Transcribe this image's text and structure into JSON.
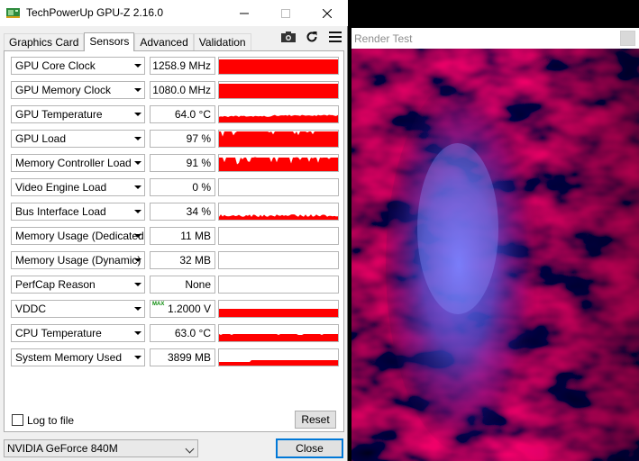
{
  "gpuz": {
    "title": "TechPowerUp GPU-Z 2.16.0",
    "icons": {
      "app": "gpu-card-icon",
      "minimize": "minimize-icon",
      "maximize": "maximize-icon",
      "close": "close-icon",
      "camera": "camera-icon",
      "refresh": "refresh-icon",
      "menu": "hamburger-menu-icon"
    },
    "tabs": [
      {
        "label": "Graphics Card",
        "active": false
      },
      {
        "label": "Sensors",
        "active": true
      },
      {
        "label": "Advanced",
        "active": false
      },
      {
        "label": "Validation",
        "active": false
      }
    ],
    "sensors": [
      {
        "name": "GPU Core Clock",
        "value": "1258.9 MHz",
        "graph": "full"
      },
      {
        "name": "GPU Memory Clock",
        "value": "1080.0 MHz",
        "graph": "full"
      },
      {
        "name": "GPU Temperature",
        "value": "64.0 °C",
        "graph": "temp"
      },
      {
        "name": "GPU Load",
        "value": "97 %",
        "graph": "load"
      },
      {
        "name": "Memory Controller Load",
        "value": "91 %",
        "graph": "memctl"
      },
      {
        "name": "Video Engine Load",
        "value": "0 %",
        "graph": "none"
      },
      {
        "name": "Bus Interface Load",
        "value": "34 %",
        "graph": "bus"
      },
      {
        "name": "Memory Usage (Dedicated)",
        "value": "11 MB",
        "graph": "none"
      },
      {
        "name": "Memory Usage (Dynamic)",
        "value": "32 MB",
        "graph": "none"
      },
      {
        "name": "PerfCap Reason",
        "value": "None",
        "graph": "none"
      },
      {
        "name": "VDDC",
        "value": "1.2000 V",
        "badge": "MAX",
        "graph": "vddc"
      },
      {
        "name": "CPU Temperature",
        "value": "63.0 °C",
        "graph": "cputemp"
      },
      {
        "name": "System Memory Used",
        "value": "3899 MB",
        "graph": "sysmem"
      }
    ],
    "log_to_file_label": "Log to file",
    "log_to_file_checked": false,
    "reset_label": "Reset",
    "gpu_selected": "NVIDIA GeForce 840M",
    "close_label": "Close",
    "graph_color": "#ff0000"
  },
  "render": {
    "title": "Render Test",
    "close_icon": "close-icon"
  }
}
